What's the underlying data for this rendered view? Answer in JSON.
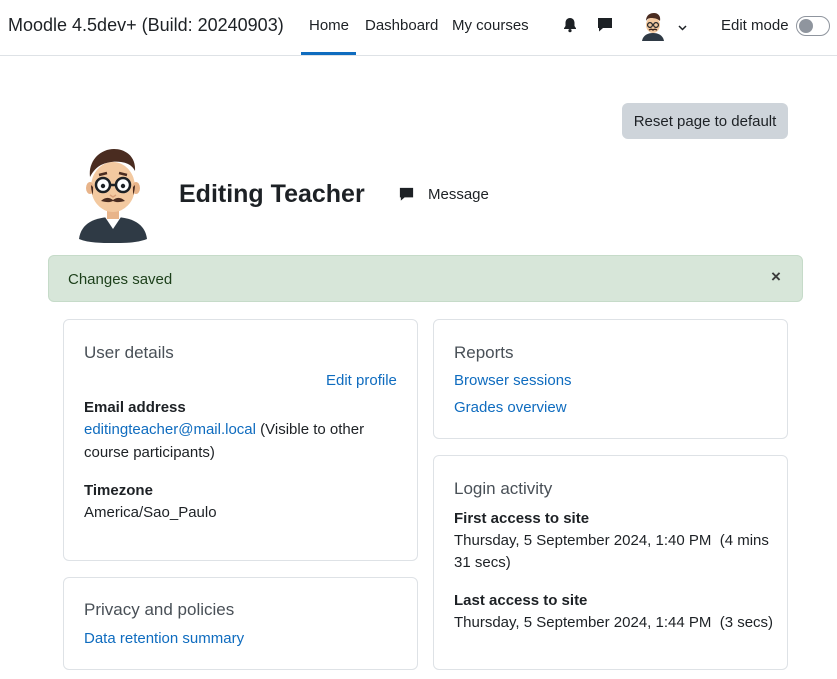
{
  "navbar": {
    "site_name": "Moodle 4.5dev+ (Build: 20240903)",
    "links": [
      {
        "label": "Home",
        "active": true
      },
      {
        "label": "Dashboard",
        "active": false
      },
      {
        "label": "My courses",
        "active": false
      }
    ],
    "icons": [
      "bell-icon",
      "chat-icon",
      "user-avatar",
      "chevron-down-icon"
    ],
    "edit_mode_label": "Edit mode",
    "edit_mode_on": false,
    "accent_color": "#0f6cbf"
  },
  "page": {
    "reset_button_label": "Reset page to default",
    "profile_name": "Editing Teacher",
    "message_label": "Message"
  },
  "alert": {
    "text": "Changes saved",
    "close_glyph": "×",
    "background": "#d7e6d9"
  },
  "user_details": {
    "title": "User details",
    "edit_profile": "Edit profile",
    "email_label": "Email address",
    "email_value": "editingteacher@mail.local",
    "email_note_line1": " (Visible to other",
    "email_note_line2": "course participants)",
    "timezone_label": "Timezone",
    "timezone_value": "America/Sao_Paulo"
  },
  "privacy": {
    "title": "Privacy and policies",
    "link": "Data retention summary"
  },
  "reports": {
    "title": "Reports",
    "links": [
      "Browser sessions",
      "Grades overview"
    ]
  },
  "login_activity": {
    "title": "Login activity",
    "first_label": "First access to site",
    "first_value_line1": "Thursday, 5 September 2024, 1:40 PM  (4 mins",
    "first_value_line2": "31 secs)",
    "last_label": "Last access to site",
    "last_value": "Thursday, 5 September 2024, 1:44 PM  (3 secs)"
  }
}
